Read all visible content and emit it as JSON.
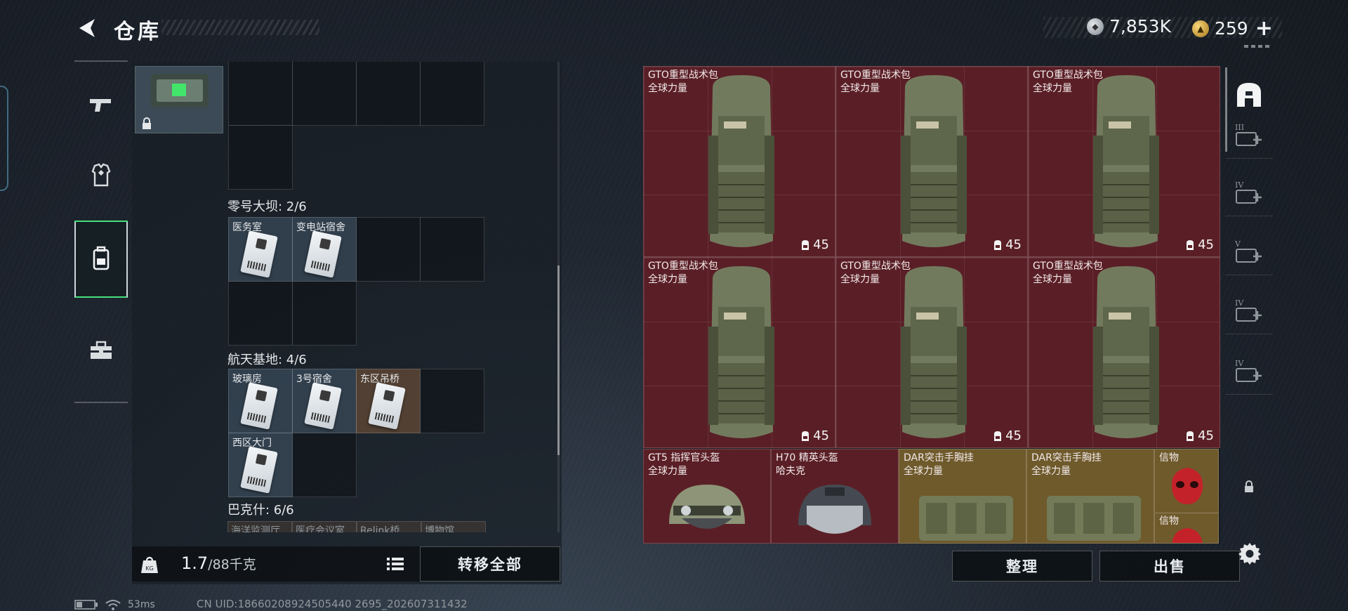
{
  "header": {
    "title": "仓库",
    "currency_silver": "7,853K",
    "currency_gold": "259",
    "plus": "+"
  },
  "storage": {
    "sections": [
      {
        "label": "零号大坝: 2/6",
        "slots": [
          "医务室",
          "变电站宿舍"
        ]
      },
      {
        "label": "航天基地: 4/6",
        "slots": [
          "玻璃房",
          "3号宿舍",
          "东区吊桥",
          "西区大门"
        ]
      },
      {
        "label": "巴克什: 6/6",
        "slots": [
          "海洋监测厅",
          "医疗会议室",
          "Relink桥",
          "博物馆"
        ]
      }
    ],
    "weight_value": "1.7",
    "weight_max": "/88千克",
    "weight_icon_text": "KG",
    "transfer_all": "转移全部"
  },
  "loot": {
    "backpacks": [
      {
        "title": "GTO重型战术包",
        "sub": "全球力量",
        "capacity": "45"
      },
      {
        "title": "GTO重型战术包",
        "sub": "全球力量",
        "capacity": "45"
      },
      {
        "title": "GTO重型战术包",
        "sub": "全球力量",
        "capacity": "45"
      },
      {
        "title": "GTO重型战术包",
        "sub": "全球力量",
        "capacity": "45"
      },
      {
        "title": "GTO重型战术包",
        "sub": "全球力量",
        "capacity": "45"
      },
      {
        "title": "GTO重型战术包",
        "sub": "全球力量",
        "capacity": "45"
      }
    ],
    "gear": [
      {
        "title": "GT5 指挥官头盔",
        "sub": "全球力量"
      },
      {
        "title": "H70 精英头盔",
        "sub": "哈夫克"
      },
      {
        "title": "DAR突击手胸挂",
        "sub": "全球力量"
      },
      {
        "title": "DAR突击手胸挂",
        "sub": "全球力量"
      }
    ],
    "relic_labels": [
      "信物",
      "信物"
    ],
    "organize": "整理",
    "sell": "出售"
  },
  "filters": [
    "III",
    "IV",
    "V",
    "IV",
    "IV"
  ],
  "status": {
    "ping": "53ms",
    "uid": "CN UID:18660208924505440 2695_202607311432"
  },
  "colors": {
    "accent_green": "#45e07c",
    "item_red": "#5a1f26",
    "item_gold": "#6f5a2c"
  }
}
